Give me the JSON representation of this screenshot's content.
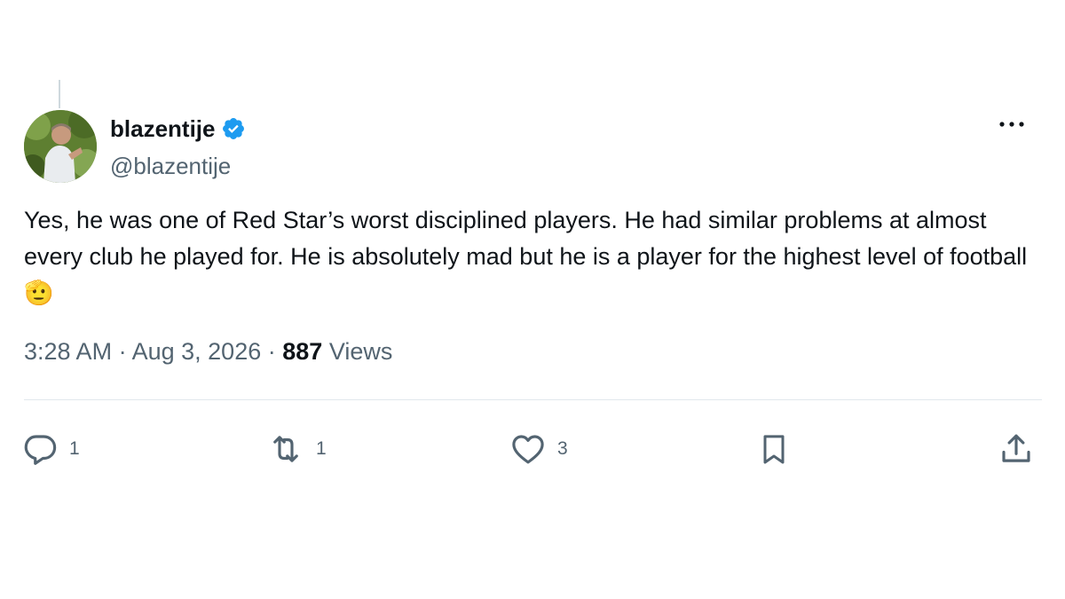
{
  "author": {
    "display_name": "blazentije",
    "handle": "@blazentije",
    "verified": true,
    "verified_color": "#1d9bf0"
  },
  "tweet": {
    "text": "Yes, he was one of Red Star’s worst disciplined players. He had similar problems at almost every club he played for. He is absolutely mad but he is a player for the highest level of football 🫡",
    "time": "3:28 AM",
    "separator": "·",
    "date": "Aug 3, 2026",
    "views_count": "887",
    "views_label": "Views"
  },
  "actions": {
    "replies": "1",
    "retweets": "1",
    "likes": "3"
  },
  "icons": {
    "more": "more-horizontal-icon",
    "reply": "reply-icon",
    "retweet": "retweet-icon",
    "like": "heart-icon",
    "bookmark": "bookmark-icon",
    "share": "share-icon",
    "verified": "verified-badge-icon"
  },
  "colors": {
    "text_primary": "#0f1419",
    "text_secondary": "#536471",
    "divider": "#e1e8ed"
  }
}
